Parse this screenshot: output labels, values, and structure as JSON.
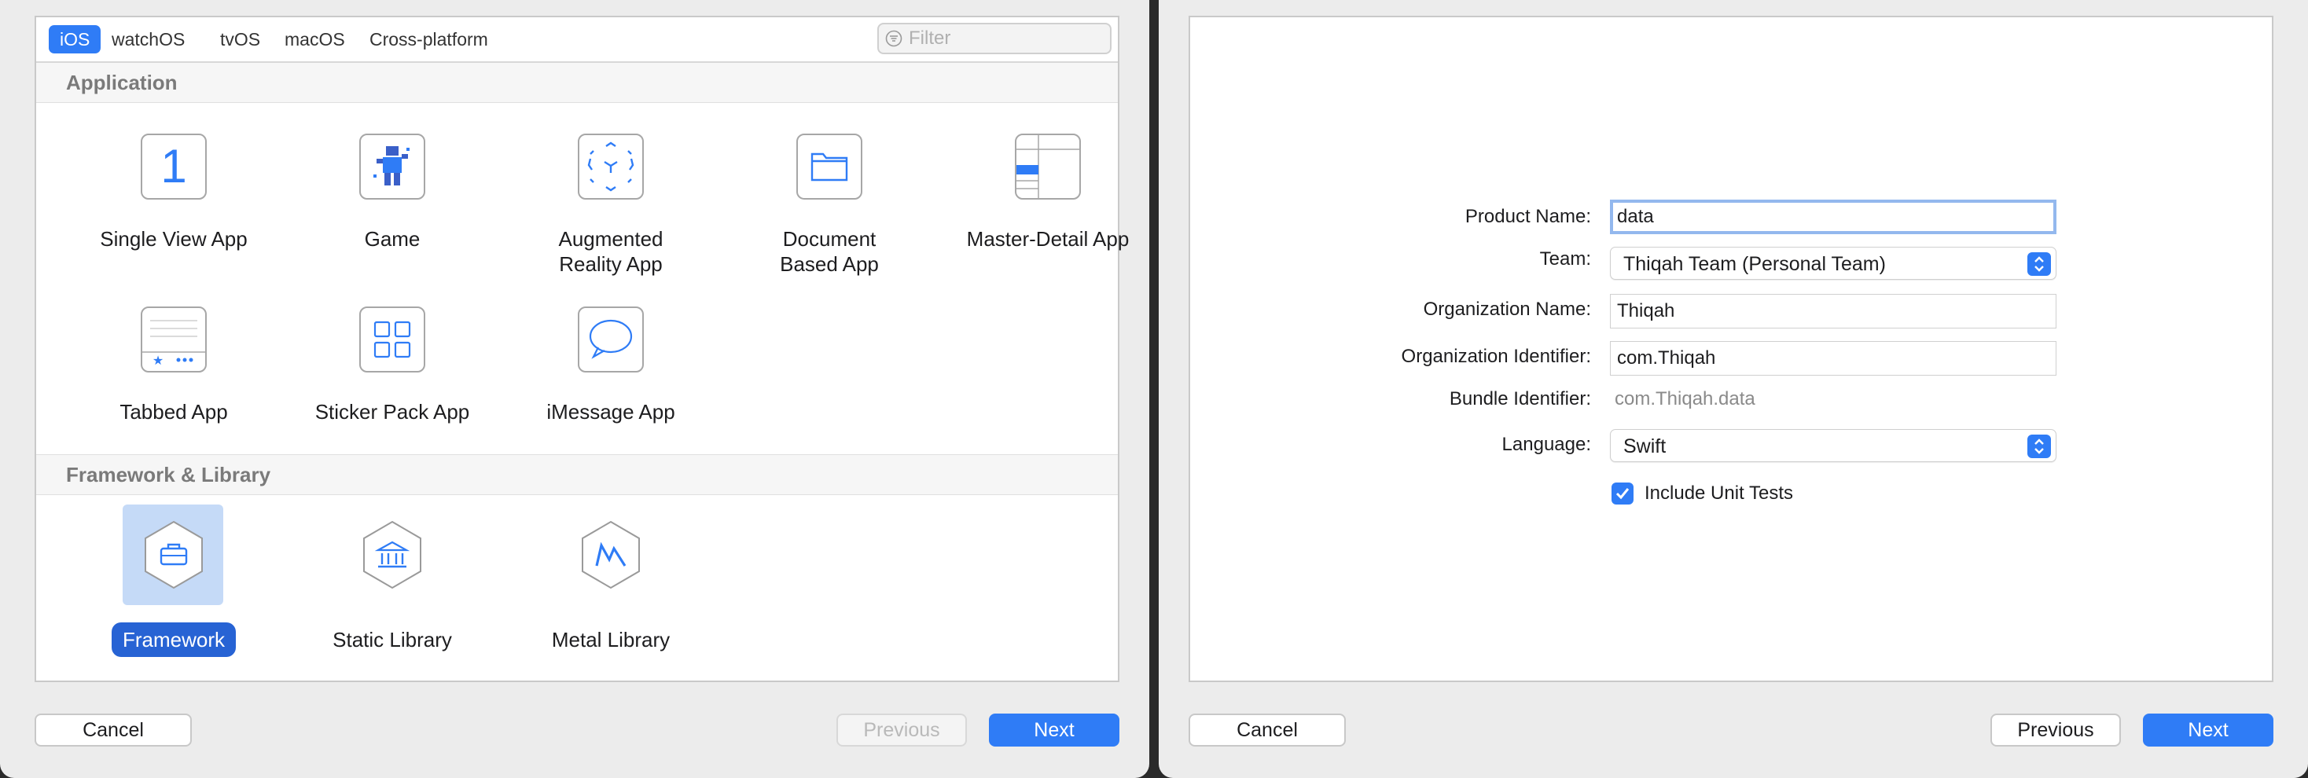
{
  "left_window": {
    "tabs": [
      "iOS",
      "watchOS",
      "tvOS",
      "macOS",
      "Cross-platform"
    ],
    "filter_placeholder": "Filter",
    "sections": {
      "application": "Application",
      "framework": "Framework & Library"
    },
    "templates": {
      "single_view": "Single View App",
      "game": "Game",
      "ar_line1": "Augmented",
      "ar_line2": "Reality App",
      "doc_line1": "Document",
      "doc_line2": "Based App",
      "master_detail": "Master-Detail App",
      "tabbed": "Tabbed App",
      "sticker": "Sticker Pack App",
      "imessage": "iMessage App",
      "framework": "Framework",
      "static_library": "Static Library",
      "metal_library": "Metal Library"
    },
    "buttons": {
      "cancel": "Cancel",
      "previous": "Previous",
      "next": "Next"
    }
  },
  "right_window": {
    "form": {
      "product_name_label": "Product Name:",
      "product_name_value": "data",
      "team_label": "Team:",
      "team_value": "Thiqah Team (Personal Team)",
      "org_name_label": "Organization Name:",
      "org_name_value": "Thiqah",
      "org_id_label": "Organization Identifier:",
      "org_id_value": "com.Thiqah",
      "bundle_label": "Bundle Identifier:",
      "bundle_value": "com.Thiqah.data",
      "language_label": "Language:",
      "language_value": "Swift",
      "unit_tests_label": "Include Unit Tests",
      "unit_tests_checked": true
    },
    "buttons": {
      "cancel": "Cancel",
      "previous": "Previous",
      "next": "Next"
    }
  },
  "colors": {
    "accent": "#2f7cf6",
    "selection": "#2763d4",
    "selection_bg": "#c5daf7"
  }
}
